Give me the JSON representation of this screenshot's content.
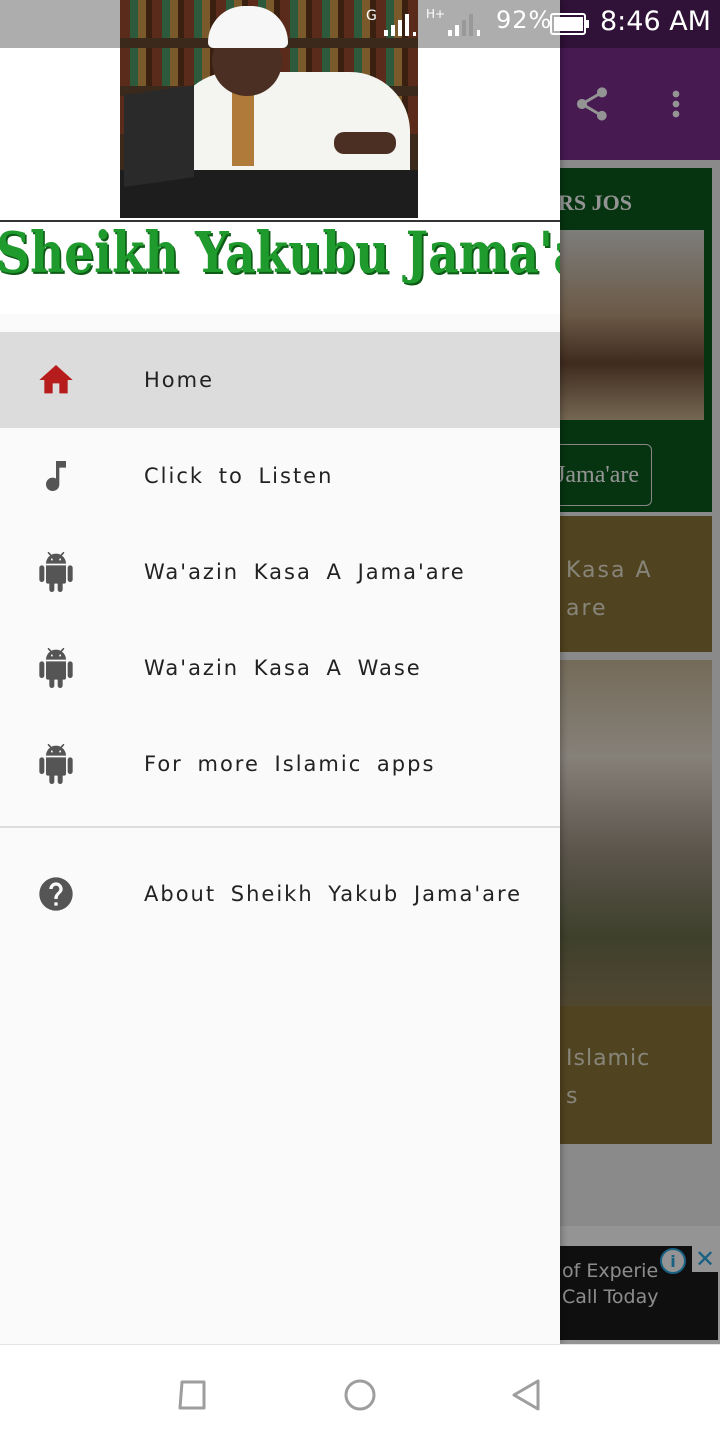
{
  "status_bar": {
    "network_g": "G",
    "network_h": "H+",
    "battery_percent": "92%",
    "time": "8:46 AM"
  },
  "app": {
    "toolbar_icons": [
      "share-icon",
      "more-vert-icon"
    ],
    "card1": {
      "title": "RS JOS",
      "button_label": "Jama'are"
    },
    "card2": {
      "line1": "Kasa  A",
      "line2": "are"
    },
    "card3": {
      "line1": "Islamic",
      "line2": "s"
    },
    "ad": {
      "line1": "of Experie",
      "line2": "Call Today",
      "info": "i",
      "close": "✕"
    }
  },
  "drawer": {
    "banner_text": "Sheikh Yakubu Jama'are",
    "items": [
      {
        "label": "Home",
        "icon": "home-icon",
        "active": true,
        "icon_color": "#b71c1c"
      },
      {
        "label": "Click to Listen",
        "icon": "music-note-icon",
        "active": false
      },
      {
        "label": "Wa'azin Kasa A Jama'are",
        "icon": "android-icon",
        "active": false
      },
      {
        "label": "Wa'azin Kasa A Wase",
        "icon": "android-icon",
        "active": false
      },
      {
        "label": "For more Islamic apps",
        "icon": "android-icon",
        "active": false
      }
    ],
    "about": {
      "label": "About Sheikh Yakub Jama'are",
      "icon": "help-icon"
    }
  },
  "colors": {
    "toolbar": "#7b2d8e",
    "card_green": "#0b5b1c",
    "card_gold": "#8a7436",
    "banner_green": "#1f9a2c",
    "icon_gray": "#555555",
    "active_bg": "#dcdcdc"
  },
  "nav_bar": [
    "recents-icon",
    "home-circle-icon",
    "back-icon"
  ]
}
